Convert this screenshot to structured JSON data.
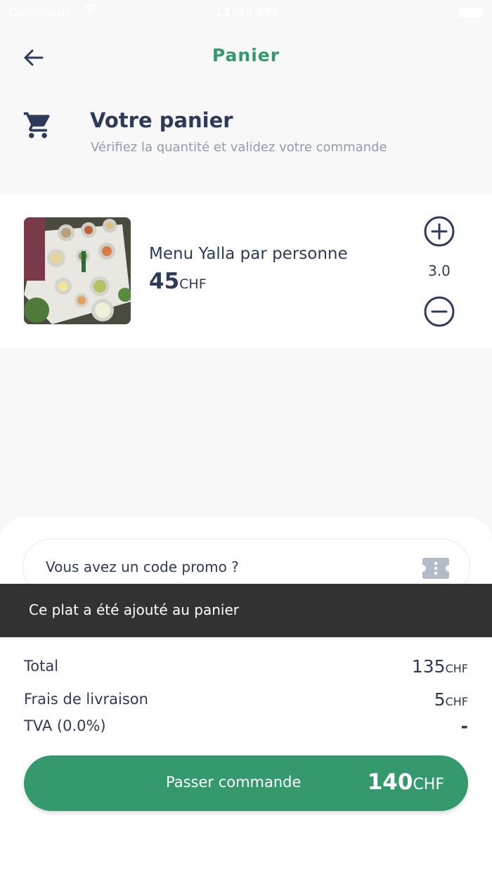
{
  "status_bar": {
    "carrier": "Opérateur",
    "time": "11:33 PM"
  },
  "nav": {
    "title": "Panier",
    "back_icon": "arrow-left-icon"
  },
  "cart_header": {
    "icon": "shopping-cart-icon",
    "title": "Votre panier",
    "subtitle": "Vérifiez la quantité et validez votre commande"
  },
  "items": [
    {
      "name": "Menu Yalla par personne",
      "price": "45",
      "currency": "CHF",
      "quantity": "3.0"
    }
  ],
  "promo": {
    "label": "Vous avez un code promo ?",
    "icon": "ticket-icon"
  },
  "snackbar": {
    "message": "Ce plat a été ajouté au panier"
  },
  "summary": {
    "total_label": "Total",
    "total_value": "135",
    "total_currency": "CHF",
    "delivery_label": "Frais de livraison",
    "delivery_value": "5",
    "delivery_currency": "CHF",
    "vat_label": "TVA (0.0%)",
    "vat_value": "-"
  },
  "order_button": {
    "label": "Passer commande",
    "amount": "140",
    "currency": "CHF"
  },
  "colors": {
    "accent": "#34996c",
    "text_primary": "#2e3a59",
    "text_secondary": "#8f9bb3",
    "snackbar": "#323232",
    "background": "#f8f8f9"
  }
}
